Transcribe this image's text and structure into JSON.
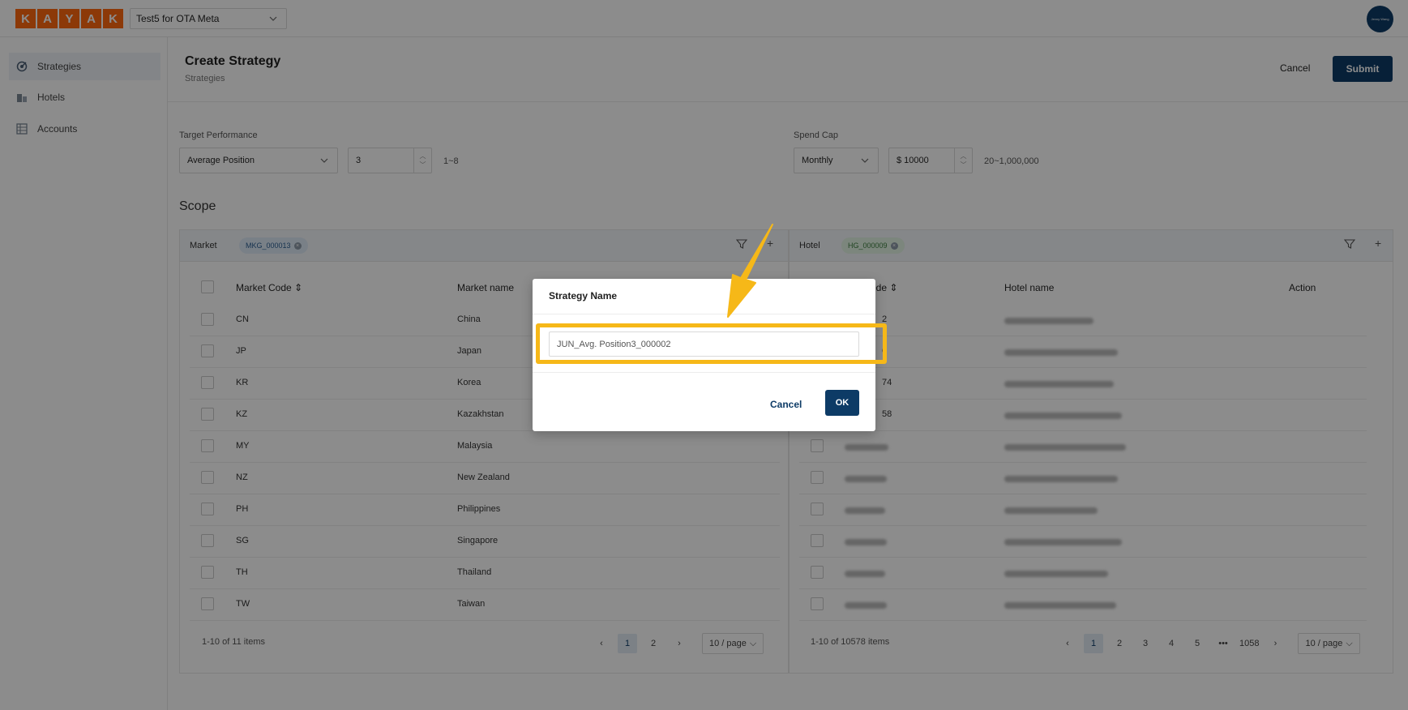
{
  "header": {
    "logo_letters": [
      "K",
      "A",
      "Y",
      "A",
      "K"
    ],
    "account_select": "Test5 for OTA Meta",
    "avatar_text": "Jenny Wang",
    "brand_color": "#ff690f",
    "accent_color": "#0d3b66"
  },
  "sidebar": {
    "items": [
      {
        "label": "Strategies",
        "icon": "strategy-icon",
        "active": true
      },
      {
        "label": "Hotels",
        "icon": "building-icon",
        "active": false
      },
      {
        "label": "Accounts",
        "icon": "grid-icon",
        "active": false
      }
    ]
  },
  "page": {
    "title": "Create Strategy",
    "breadcrumb": "Strategies",
    "cancel_label": "Cancel",
    "submit_label": "Submit"
  },
  "form": {
    "target_label": "Target Performance",
    "target_metric": "Average Position",
    "target_value": "3",
    "target_hint": "1~8",
    "spend_label": "Spend Cap",
    "spend_period": "Monthly",
    "spend_value": "$ 10000",
    "spend_hint": "20~1,000,000"
  },
  "scope": {
    "title": "Scope",
    "market": {
      "label": "Market",
      "chip": "MKG_000013",
      "columns": [
        "Market Code",
        "Market name"
      ],
      "rows": [
        {
          "code": "CN",
          "name": "China"
        },
        {
          "code": "JP",
          "name": "Japan"
        },
        {
          "code": "KR",
          "name": "Korea"
        },
        {
          "code": "KZ",
          "name": "Kazakhstan"
        },
        {
          "code": "MY",
          "name": "Malaysia"
        },
        {
          "code": "NZ",
          "name": "New Zealand"
        },
        {
          "code": "PH",
          "name": "Philippines"
        },
        {
          "code": "SG",
          "name": "Singapore"
        },
        {
          "code": "TH",
          "name": "Thailand"
        },
        {
          "code": "TW",
          "name": "Taiwan"
        }
      ],
      "total": "1-10 of 11 items",
      "pages": [
        "1",
        "2"
      ],
      "page_size": "10 / page"
    },
    "hotel": {
      "label": "Hotel",
      "chip": "HG_000009",
      "columns": [
        "ode",
        "Hotel name",
        "Action"
      ],
      "visible_codes": [
        "2",
        "6",
        "74",
        "58"
      ],
      "total": "1-10 of 10578 items",
      "pages": [
        "1",
        "2",
        "3",
        "4",
        "5",
        "•••",
        "1058"
      ],
      "page_size": "10 / page"
    }
  },
  "modal": {
    "title": "Strategy Name",
    "input_value": "JUN_Avg. Position3_000002",
    "cancel_label": "Cancel",
    "ok_label": "OK",
    "highlight_color": "#f6b818"
  }
}
